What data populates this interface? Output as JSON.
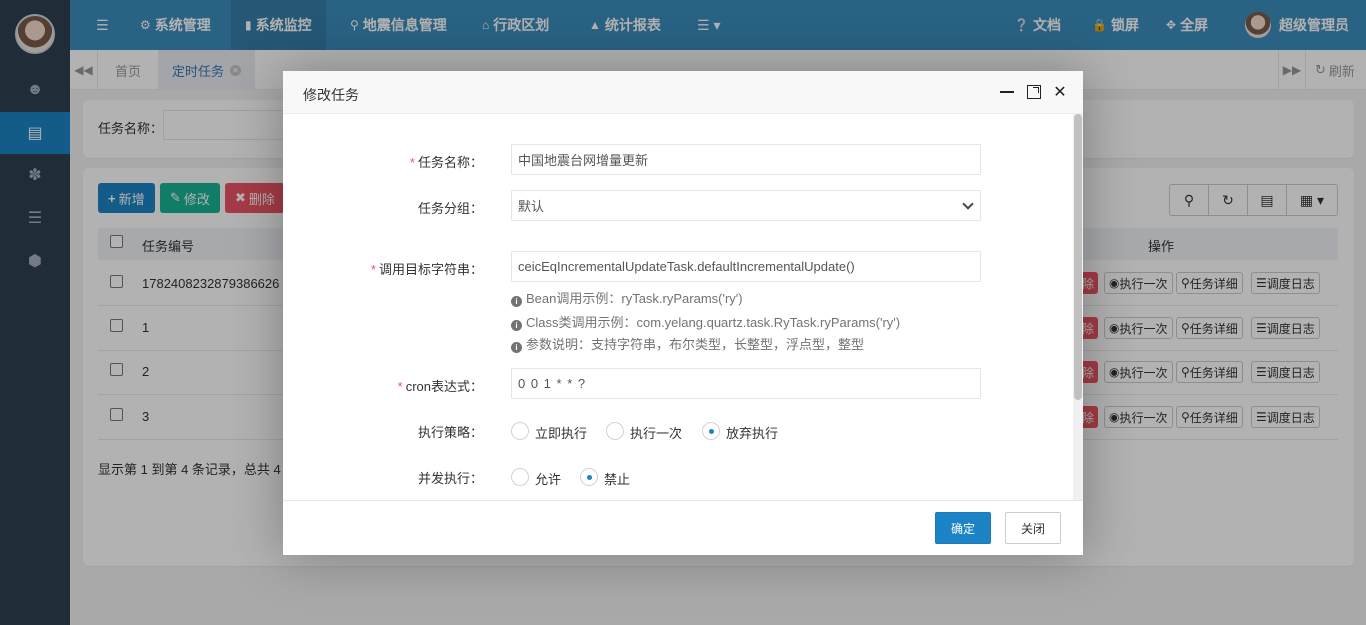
{
  "nav": {
    "menu_items": [
      "系统管理",
      "系统监控",
      "地震信息管理",
      "行政区划",
      "统计报表"
    ],
    "right_items": [
      "文档",
      "锁屏",
      "全屏"
    ],
    "user_name": "超级管理员"
  },
  "tabs": {
    "home": "首页",
    "active": "定时任务",
    "refresh": "刷新"
  },
  "search": {
    "label": "任务名称："
  },
  "toolbar": {
    "add": "新增",
    "edit": "修改",
    "delete": "删除"
  },
  "table": {
    "headers": {
      "id": "任务编号",
      "ops": "操作"
    },
    "rows": [
      {
        "id": "1782408232879386626"
      },
      {
        "id": "1"
      },
      {
        "id": "2"
      },
      {
        "id": "3"
      }
    ],
    "row_actions": {
      "delete_tail": "除",
      "run_once": "执行一次",
      "detail": "任务详细",
      "log": "调度日志"
    },
    "pagination": "显示第 1 到第 4 条记录，总共 4"
  },
  "modal": {
    "title": "修改任务",
    "fields": {
      "job_name": {
        "label": "任务名称：",
        "value": "中国地震台网增量更新"
      },
      "job_group": {
        "label": "任务分组：",
        "value": "默认"
      },
      "invoke_target": {
        "label": "调用目标字符串：",
        "value": "ceicEqIncrementalUpdateTask.defaultIncrementalUpdate()"
      },
      "cron": {
        "label": "cron表达式：",
        "value": "0 0 1 * * ?"
      },
      "misfire": {
        "label": "执行策略：",
        "options": [
          "立即执行",
          "执行一次",
          "放弃执行"
        ],
        "selected": "放弃执行"
      },
      "concurrent": {
        "label": "并发执行：",
        "options": [
          "允许",
          "禁止"
        ],
        "selected": "禁止"
      }
    },
    "help": [
      "Bean调用示例：ryTask.ryParams('ry')",
      "Class类调用示例：com.yelang.quartz.task.RyTask.ryParams('ry')",
      "参数说明：支持字符串，布尔类型，长整型，浮点型，整型"
    ],
    "confirm": "确定",
    "close": "关闭"
  },
  "colors": {
    "sidebar": "#2f4050",
    "topnav": "#3c8dbc",
    "primary": "#1c84c6",
    "add_btn": "#1c84c6",
    "edit_btn": "#1ab394",
    "delete_btn": "#ed5565"
  }
}
